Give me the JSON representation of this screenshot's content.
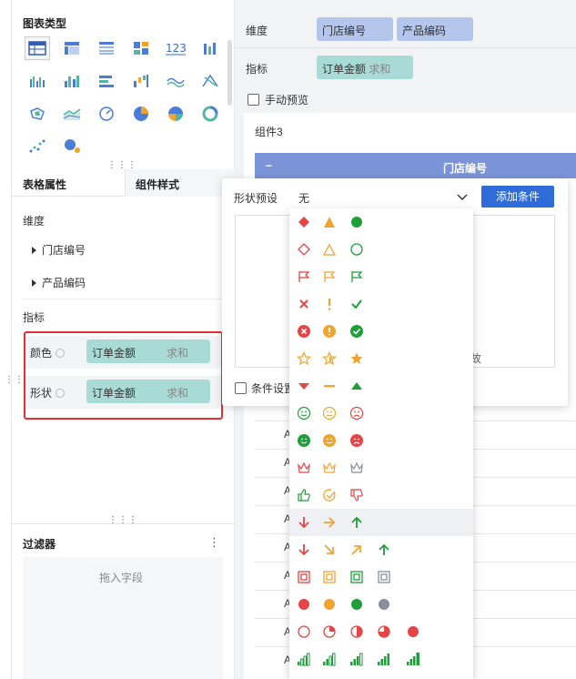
{
  "left": {
    "chart_type_title": "图表类型",
    "chart_type_icons": [
      "table-icon",
      "cross-table-icon",
      "detail-table-icon",
      "block-icon",
      "number-card-icon",
      "grouped-bar-icon",
      "bar-icon",
      "clustered-bar-icon",
      "horizontal-bar-icon",
      "waterfall-icon",
      "line-icon",
      "radar-icon",
      "map-icon",
      "area-icon",
      "gauge-icon",
      "pie-icon",
      "rose-icon",
      "ring-icon",
      "scatter-icon",
      "bubble-icon"
    ],
    "tabs": {
      "table_props": "表格属性",
      "component_style": "组件样式"
    },
    "dimension_label": "维度",
    "dimensions": [
      "门店编号",
      "产品编码"
    ],
    "metric_label": "指标",
    "color_label": "颜色",
    "shape_label": "形状",
    "metric_field": "订单金额",
    "metric_agg": "求和",
    "filter_title": "过滤器",
    "filter_placeholder": "拖入字段",
    "more": "⋮"
  },
  "right": {
    "dimension_label": "维度",
    "dimension_pills": [
      "门店编号",
      "产品编码"
    ],
    "metric_label": "指标",
    "metric_field": "订单金额",
    "metric_agg": "求和",
    "manual_preview": "手动预览",
    "component_name": "组件3",
    "table_header": "门店编号",
    "collapse": "−",
    "row_prefix": "A"
  },
  "popup": {
    "shape_preset_label": "形状预设",
    "selected": "无",
    "add_condition": "添加条件",
    "condition_settings": "条件设置",
    "partial_text": "故"
  },
  "colors": {
    "red": "#e54545",
    "orange": "#f0a430",
    "green": "#1f9e3a",
    "gray": "#8a8f99",
    "accent": "#2f6bd9"
  },
  "shape_options": [
    {
      "name": "diamond-triangle-circle-filled"
    },
    {
      "name": "diamond-triangle-circle-outline"
    },
    {
      "name": "flags"
    },
    {
      "name": "cross-exclaim-check"
    },
    {
      "name": "circle-cross-exclaim-check"
    },
    {
      "name": "stars"
    },
    {
      "name": "arrow-triangles"
    },
    {
      "name": "smiley-outline"
    },
    {
      "name": "smiley-filled"
    },
    {
      "name": "crowns"
    },
    {
      "name": "thumbs"
    },
    {
      "name": "arrows-3"
    },
    {
      "name": "arrows-4"
    },
    {
      "name": "squares"
    },
    {
      "name": "dots-4"
    },
    {
      "name": "pies-5"
    },
    {
      "name": "signal-bars"
    }
  ]
}
